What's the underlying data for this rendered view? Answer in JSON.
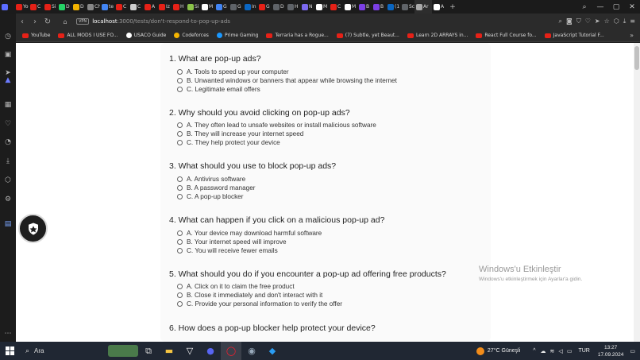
{
  "browser": {
    "tabs": [
      {
        "label": "",
        "color": "#5b6cff"
      },
      {
        "label": "Yo",
        "color": "#e62117"
      },
      {
        "label": "C",
        "color": "#e62117"
      },
      {
        "label": "Si",
        "color": "#e62117"
      },
      {
        "label": "D",
        "color": "#25d366"
      },
      {
        "label": "D",
        "color": "#f4b400"
      },
      {
        "label": "Ch",
        "color": "#888888"
      },
      {
        "label": "te",
        "color": "#4285f4"
      },
      {
        "label": "C",
        "color": "#e62117"
      },
      {
        "label": "C",
        "color": "#cccccc"
      },
      {
        "label": "A",
        "color": "#e62117"
      },
      {
        "label": "Iz",
        "color": "#e62117"
      },
      {
        "label": "H",
        "color": "#e62117"
      },
      {
        "label": "Si",
        "color": "#8bc34a"
      },
      {
        "label": "M",
        "color": "#ffffff"
      },
      {
        "label": "G",
        "color": "#4285f4"
      },
      {
        "label": "G",
        "color": "#5f6368"
      },
      {
        "label": "In",
        "color": "#0a66c2"
      },
      {
        "label": "G",
        "color": "#e62117"
      },
      {
        "label": "D",
        "color": "#5f6368"
      },
      {
        "label": "H",
        "color": "#5f6368"
      },
      {
        "label": "N",
        "color": "#7b68ee"
      },
      {
        "label": "M",
        "color": "#ffffff"
      },
      {
        "label": "C",
        "color": "#e62117"
      },
      {
        "label": "M",
        "color": "#ffffff"
      },
      {
        "label": "B",
        "color": "#7b3fe4"
      },
      {
        "label": "B",
        "color": "#7b3fe4"
      },
      {
        "label": "(1",
        "color": "#0a66c2"
      },
      {
        "label": "Sc",
        "color": "#5f6368"
      },
      {
        "label": "Ar",
        "color": "#aaaaaa",
        "active": true
      },
      {
        "label": "A",
        "color": "#ffffff"
      }
    ],
    "url_host": "localhost",
    "url_path": ":3000/tests/don't-respond-to-pop-up-ads",
    "vpn_label": "VPN",
    "bookmarks": [
      {
        "label": "YouTube",
        "kind": "yt"
      },
      {
        "label": "ALL MODS I USE FO...",
        "kind": "yt"
      },
      {
        "label": "USACO Guide",
        "kind": "ic",
        "color": "#ffffff"
      },
      {
        "label": "Codeforces",
        "kind": "ic",
        "color": "#f4b400"
      },
      {
        "label": "Prime Gaming",
        "kind": "ic",
        "color": "#1a98ff"
      },
      {
        "label": "Terraria has a Rogue...",
        "kind": "yt"
      },
      {
        "label": "(7) Subtle, yet Beaut...",
        "kind": "yt"
      },
      {
        "label": "Learn 2D ARRAYS in...",
        "kind": "yt"
      },
      {
        "label": "React Full Course fo...",
        "kind": "yt"
      },
      {
        "label": "JavaScript Tutorial F...",
        "kind": "yt"
      }
    ]
  },
  "quiz": {
    "questions": [
      {
        "title": "1. What are pop-up ads?",
        "options": [
          "A. Tools to speed up your computer",
          "B. Unwanted windows or banners that appear while browsing the internet",
          "C. Legitimate email offers"
        ]
      },
      {
        "title": "2. Why should you avoid clicking on pop-up ads?",
        "options": [
          "A. They often lead to unsafe websites or install malicious software",
          "B. They will increase your internet speed",
          "C. They help protect your device"
        ]
      },
      {
        "title": "3. What should you use to block pop-up ads?",
        "options": [
          "A. Antivirus software",
          "B. A password manager",
          "C. A pop-up blocker"
        ]
      },
      {
        "title": "4. What can happen if you click on a malicious pop-up ad?",
        "options": [
          "A. Your device may download harmful software",
          "B. Your internet speed will improve",
          "C. You will receive fewer emails"
        ]
      },
      {
        "title": "5. What should you do if you encounter a pop-up ad offering free products?",
        "options": [
          "A. Click on it to claim the free product",
          "B. Close it immediately and don't interact with it",
          "C. Provide your personal information to verify the offer"
        ]
      },
      {
        "title": "6. How does a pop-up blocker help protect your device?",
        "options": []
      }
    ]
  },
  "watermark": {
    "title": "Windows'u Etkinleştir",
    "subtitle": "Windows'u etkinleştirmek için Ayarlar'a gidin."
  },
  "taskbar": {
    "search_label": "Ara",
    "weather": "27°C  Güneşli",
    "language": "TUR",
    "time": "13:27",
    "date": "17.09.2024"
  }
}
